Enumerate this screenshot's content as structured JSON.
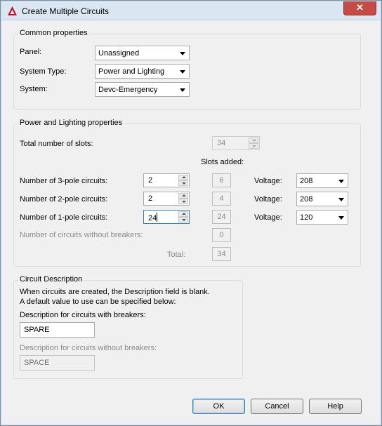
{
  "window": {
    "title": "Create Multiple Circuits",
    "close_glyph": "✕",
    "icon": "app-a-icon",
    "accent": "#c74b45"
  },
  "common": {
    "title": "Common properties",
    "panel_label": "Panel:",
    "panel_value": "Unassigned",
    "system_type_label": "System Type:",
    "system_type_value": "Power and Lighting",
    "system_label": "System:",
    "system_value": "Devc-Emergency"
  },
  "power": {
    "title": "Power and Lighting properties",
    "total_slots_label": "Total number of slots:",
    "total_slots_value": "34",
    "slots_added_header": "Slots added:",
    "rows": [
      {
        "label": "Number of 3-pole circuits:",
        "count": "2",
        "slots": "6",
        "voltage_label": "Voltage:",
        "voltage": "208"
      },
      {
        "label": "Number of 2-pole circuits:",
        "count": "2",
        "slots": "4",
        "voltage_label": "Voltage:",
        "voltage": "208"
      },
      {
        "label": "Number of 1-pole circuits:",
        "count": "24",
        "slots": "24",
        "voltage_label": "Voltage:",
        "voltage": "120"
      }
    ],
    "no_breakers_label": "Number of circuits without breakers:",
    "no_breakers_value": "0",
    "total_label": "Total:",
    "total_value": "34"
  },
  "description": {
    "title": "Circuit Description",
    "info_line1": "When circuits are created, the Description field is blank.",
    "info_line2": "A default value to use can be specified below:",
    "with_label": "Description for circuits with breakers:",
    "with_value": "SPARE",
    "without_label": "Description for circuits without breakers:",
    "without_value": "SPACE"
  },
  "buttons": {
    "ok": "OK",
    "cancel": "Cancel",
    "help": "Help"
  }
}
